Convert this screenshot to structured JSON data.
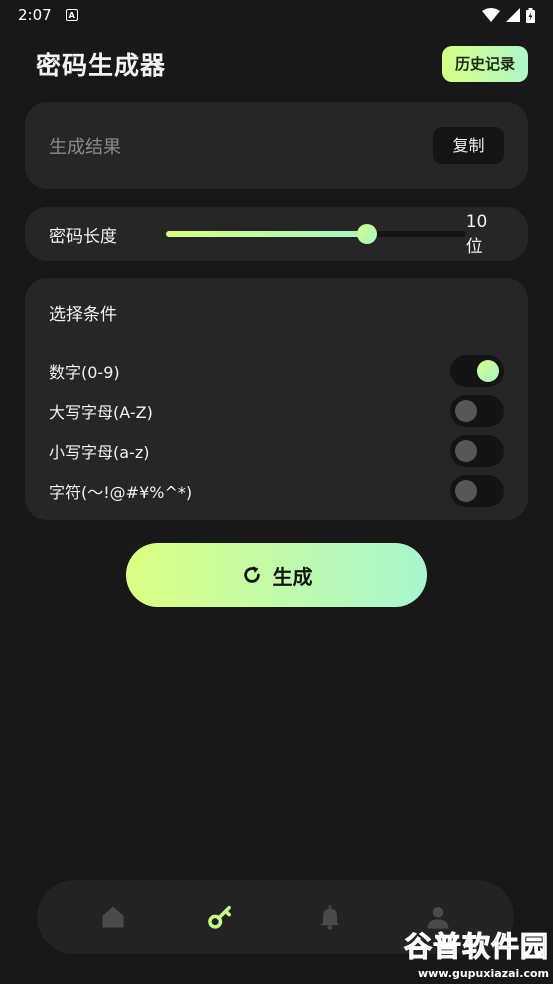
{
  "status_bar": {
    "time": "2:07",
    "indicator_a": "A"
  },
  "header": {
    "title": "密码生成器",
    "history_button": "历史记录"
  },
  "result": {
    "placeholder": "生成结果",
    "copy_button": "复制"
  },
  "length": {
    "label": "密码长度",
    "value_text": "10位",
    "slider_fraction": 0.67
  },
  "options": {
    "title": "选择条件",
    "items": [
      {
        "label": "数字(0-9)",
        "enabled": true
      },
      {
        "label": "大写字母(A-Z)",
        "enabled": false
      },
      {
        "label": "小写字母(a-z)",
        "enabled": false
      },
      {
        "label": "字符(～!@#¥%^*)",
        "enabled": false
      }
    ]
  },
  "generate_button": {
    "label": "生成",
    "icon": "refresh-icon"
  },
  "bottom_nav": {
    "items": [
      {
        "icon": "home-icon",
        "active": false
      },
      {
        "icon": "key-icon",
        "active": true
      },
      {
        "icon": "bell-icon",
        "active": false
      },
      {
        "icon": "user-icon",
        "active": false
      }
    ]
  },
  "watermark": {
    "main": "谷普软件园",
    "sub": "www.gupuxiazai.com"
  },
  "colors": {
    "background": "#181818",
    "card": "#262626",
    "accent_start": "#d6ff86",
    "accent_end": "#a6f5c6",
    "inactive_icon": "#4a4a4a"
  }
}
